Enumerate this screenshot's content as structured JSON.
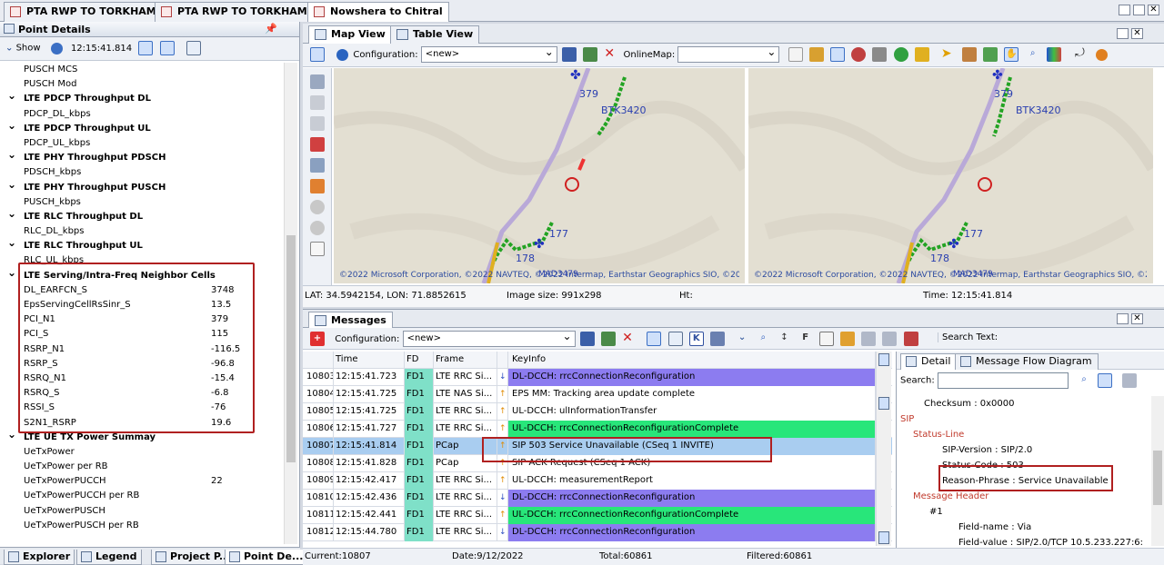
{
  "doc_tabs": [
    {
      "label": "PTA RWP TO TORKHAM",
      "active": false
    },
    {
      "label": "PTA RWP TO TORKHAM",
      "active": false
    },
    {
      "label": "Nowshera to Chitral",
      "active": true
    }
  ],
  "point_details": {
    "title": "Point Details",
    "pin": "📌",
    "show_label": "Show",
    "time": "12:15:41.814",
    "rows": [
      {
        "label": "PUSCH MCS",
        "group": false,
        "value": ""
      },
      {
        "label": "PUSCH Mod",
        "group": false,
        "value": ""
      },
      {
        "label": "LTE PDCP Throughput DL",
        "group": true,
        "value": ""
      },
      {
        "label": "PDCP_DL_kbps",
        "group": false,
        "value": ""
      },
      {
        "label": "LTE PDCP Throughput UL",
        "group": true,
        "value": ""
      },
      {
        "label": "PDCP_UL_kbps",
        "group": false,
        "value": ""
      },
      {
        "label": "LTE PHY Throughput PDSCH",
        "group": true,
        "value": ""
      },
      {
        "label": "PDSCH_kbps",
        "group": false,
        "value": ""
      },
      {
        "label": "LTE PHY Throughput PUSCH",
        "group": true,
        "value": ""
      },
      {
        "label": "PUSCH_kbps",
        "group": false,
        "value": ""
      },
      {
        "label": "LTE RLC Throughput DL",
        "group": true,
        "value": ""
      },
      {
        "label": "RLC_DL_kbps",
        "group": false,
        "value": ""
      },
      {
        "label": "LTE RLC Throughput UL",
        "group": true,
        "value": ""
      },
      {
        "label": "RLC_UL_kbps",
        "group": false,
        "value": ""
      },
      {
        "label": "LTE Serving/Intra-Freq Neighbor Cells",
        "group": true,
        "value": ""
      },
      {
        "label": "DL_EARFCN_S",
        "group": false,
        "value": "3748"
      },
      {
        "label": "EpsServingCellRsSinr_S",
        "group": false,
        "value": "13.5"
      },
      {
        "label": "PCI_N1",
        "group": false,
        "value": "379"
      },
      {
        "label": "PCI_S",
        "group": false,
        "value": "115"
      },
      {
        "label": "RSRP_N1",
        "group": false,
        "value": "-116.5"
      },
      {
        "label": "RSRP_S",
        "group": false,
        "value": "-96.8"
      },
      {
        "label": "RSRQ_N1",
        "group": false,
        "value": "-15.4"
      },
      {
        "label": "RSRQ_S",
        "group": false,
        "value": "-6.8"
      },
      {
        "label": "RSSI_S",
        "group": false,
        "value": "-76"
      },
      {
        "label": "S2N1_RSRP",
        "group": false,
        "value": "19.6"
      },
      {
        "label": "LTE UE TX Power Summay",
        "group": true,
        "value": ""
      },
      {
        "label": "UeTxPower",
        "group": false,
        "value": ""
      },
      {
        "label": "UeTxPower per RB",
        "group": false,
        "value": ""
      },
      {
        "label": "UeTxPowerPUCCH",
        "group": false,
        "value": "22"
      },
      {
        "label": "UeTxPowerPUCCH per RB",
        "group": false,
        "value": ""
      },
      {
        "label": "UeTxPowerPUSCH",
        "group": false,
        "value": ""
      },
      {
        "label": "UeTxPowerPUSCH per RB",
        "group": false,
        "value": ""
      }
    ]
  },
  "bottom_tabs": [
    {
      "label": "Explorer",
      "active": false
    },
    {
      "label": "Legend",
      "active": false
    },
    {
      "label": "Project P...",
      "active": false
    },
    {
      "label": "Point De...",
      "active": true
    }
  ],
  "map": {
    "tab_map": "Map View",
    "tab_table": "Table View",
    "config_label": "Configuration:",
    "config_value": "<new>",
    "online_map_label": "OnlineMap:",
    "online_map_value": "",
    "label_379": "379",
    "label_btk": "BTK3420",
    "label_177": "177",
    "label_178": "178",
    "label_mad": "MAD3479",
    "credit": "©2022 Microsoft Corporation, ©2022 NAVTEQ, ©2022 Intermap, Earthstar Geographics SIO, ©2022 Maxar, Image courtesy of NASA",
    "status_latlon": "LAT: 34.5942154, LON: 71.8852615",
    "status_imagesize": "Image size: 991x298",
    "status_ht": "Ht:",
    "status_time": "Time: 12:15:41.814"
  },
  "messages": {
    "title": "Messages",
    "config_label": "Configuration:",
    "config_value": "<new>",
    "search_label": "Search Text:",
    "columns": [
      "",
      "Time",
      "FD",
      "Frame",
      "",
      "KeyInfo"
    ],
    "rows": [
      {
        "id": "10803",
        "time": "12:15:41.723",
        "fd": "FD1",
        "frame": "LTE RRC Si...",
        "dir": "down",
        "info": "DL-DCCH: rrcConnectionReconfiguration",
        "color": "#8c7cf0"
      },
      {
        "id": "10804",
        "time": "12:15:41.725",
        "fd": "FD1",
        "frame": "LTE NAS Si...",
        "dir": "up",
        "info": "EPS MM: Tracking area update complete",
        "color": "#ffffff"
      },
      {
        "id": "10805",
        "time": "12:15:41.725",
        "fd": "FD1",
        "frame": "LTE RRC Si...",
        "dir": "up",
        "info": "UL-DCCH: ulInformationTransfer",
        "color": "#ffffff"
      },
      {
        "id": "10806",
        "time": "12:15:41.727",
        "fd": "FD1",
        "frame": "LTE RRC Si...",
        "dir": "up",
        "info": "UL-DCCH: rrcConnectionReconfigurationComplete",
        "color": "#28e67a"
      },
      {
        "id": "10807",
        "time": "12:15:41.814",
        "fd": "FD1",
        "frame": "PCap",
        "dir": "up",
        "info": "SIP 503 Service Unavailable (CSeq 1 INVITE)",
        "color": "#a9cdf0"
      },
      {
        "id": "10808",
        "time": "12:15:41.828",
        "fd": "FD1",
        "frame": "PCap",
        "dir": "up",
        "info": "SIP ACK Request (CSeq 1 ACK)",
        "color": "#ffffff"
      },
      {
        "id": "10809",
        "time": "12:15:42.417",
        "fd": "FD1",
        "frame": "LTE RRC Si...",
        "dir": "up",
        "info": "UL-DCCH: measurementReport",
        "color": "#ffffff"
      },
      {
        "id": "10810",
        "time": "12:15:42.436",
        "fd": "FD1",
        "frame": "LTE RRC Si...",
        "dir": "down",
        "info": "DL-DCCH: rrcConnectionReconfiguration",
        "color": "#8c7cf0"
      },
      {
        "id": "10811",
        "time": "12:15:42.441",
        "fd": "FD1",
        "frame": "LTE RRC Si...",
        "dir": "up",
        "info": "UL-DCCH: rrcConnectionReconfigurationComplete",
        "color": "#28e67a"
      },
      {
        "id": "10812",
        "time": "12:15:44.780",
        "fd": "FD1",
        "frame": "LTE RRC Si...",
        "dir": "down",
        "info": "DL-DCCH: rrcConnectionReconfiguration",
        "color": "#8c7cf0"
      }
    ],
    "detail_tab": "Detail",
    "flow_tab": "Message Flow Diagram",
    "search_field_label": "Search:",
    "tree": [
      {
        "text": "Checksum : 0x0000",
        "indent": 30,
        "red": false
      },
      {
        "text": "SIP",
        "indent": 4,
        "red": true
      },
      {
        "text": "Status-Line",
        "indent": 18,
        "red": true
      },
      {
        "text": "SIP-Version : SIP/2.0",
        "indent": 50,
        "red": false
      },
      {
        "text": "Status-Code : 503",
        "indent": 50,
        "red": false
      },
      {
        "text": "Reason-Phrase : Service Unavailable",
        "indent": 50,
        "red": false
      },
      {
        "text": "Message Header",
        "indent": 18,
        "red": true
      },
      {
        "text": "#1",
        "indent": 36,
        "red": false
      },
      {
        "text": "Field-name : Via",
        "indent": 68,
        "red": false
      },
      {
        "text": "Field-value : SIP/2.0/TCP 10.5.233.227:6:",
        "indent": 68,
        "red": false
      }
    ],
    "status_current": "Current:10807",
    "status_date": "Date:9/12/2022",
    "status_total": "Total:60861",
    "status_filtered": "Filtered:60861"
  }
}
